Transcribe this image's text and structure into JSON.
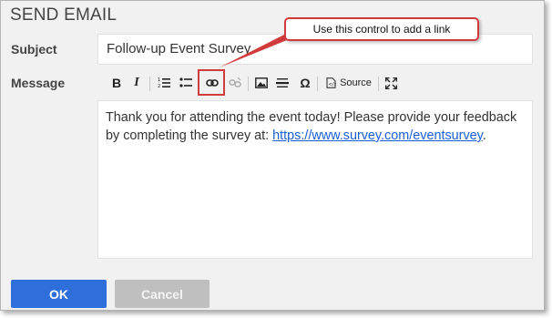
{
  "dialog": {
    "title": "SEND EMAIL"
  },
  "form": {
    "subject_label": "Subject",
    "subject_value": "Follow-up Event Survey",
    "message_label": "Message"
  },
  "toolbar": {
    "bold": "B",
    "italic": "I",
    "source_label": "Source",
    "omega": "Ω"
  },
  "message": {
    "text_before": "Thank you for attending the event today! Please provide your feedback by completing the survey at: ",
    "link_text": "https://www.survey.com/eventsurvey",
    "text_after": "."
  },
  "buttons": {
    "ok": "OK",
    "cancel": "Cancel"
  },
  "annotation": {
    "callout_text": "Use this control to add a link",
    "color": "#d23b3b"
  },
  "colors": {
    "primary": "#2f6fdc",
    "disabled": "#bfbfbf",
    "link": "#1a5fd6"
  }
}
